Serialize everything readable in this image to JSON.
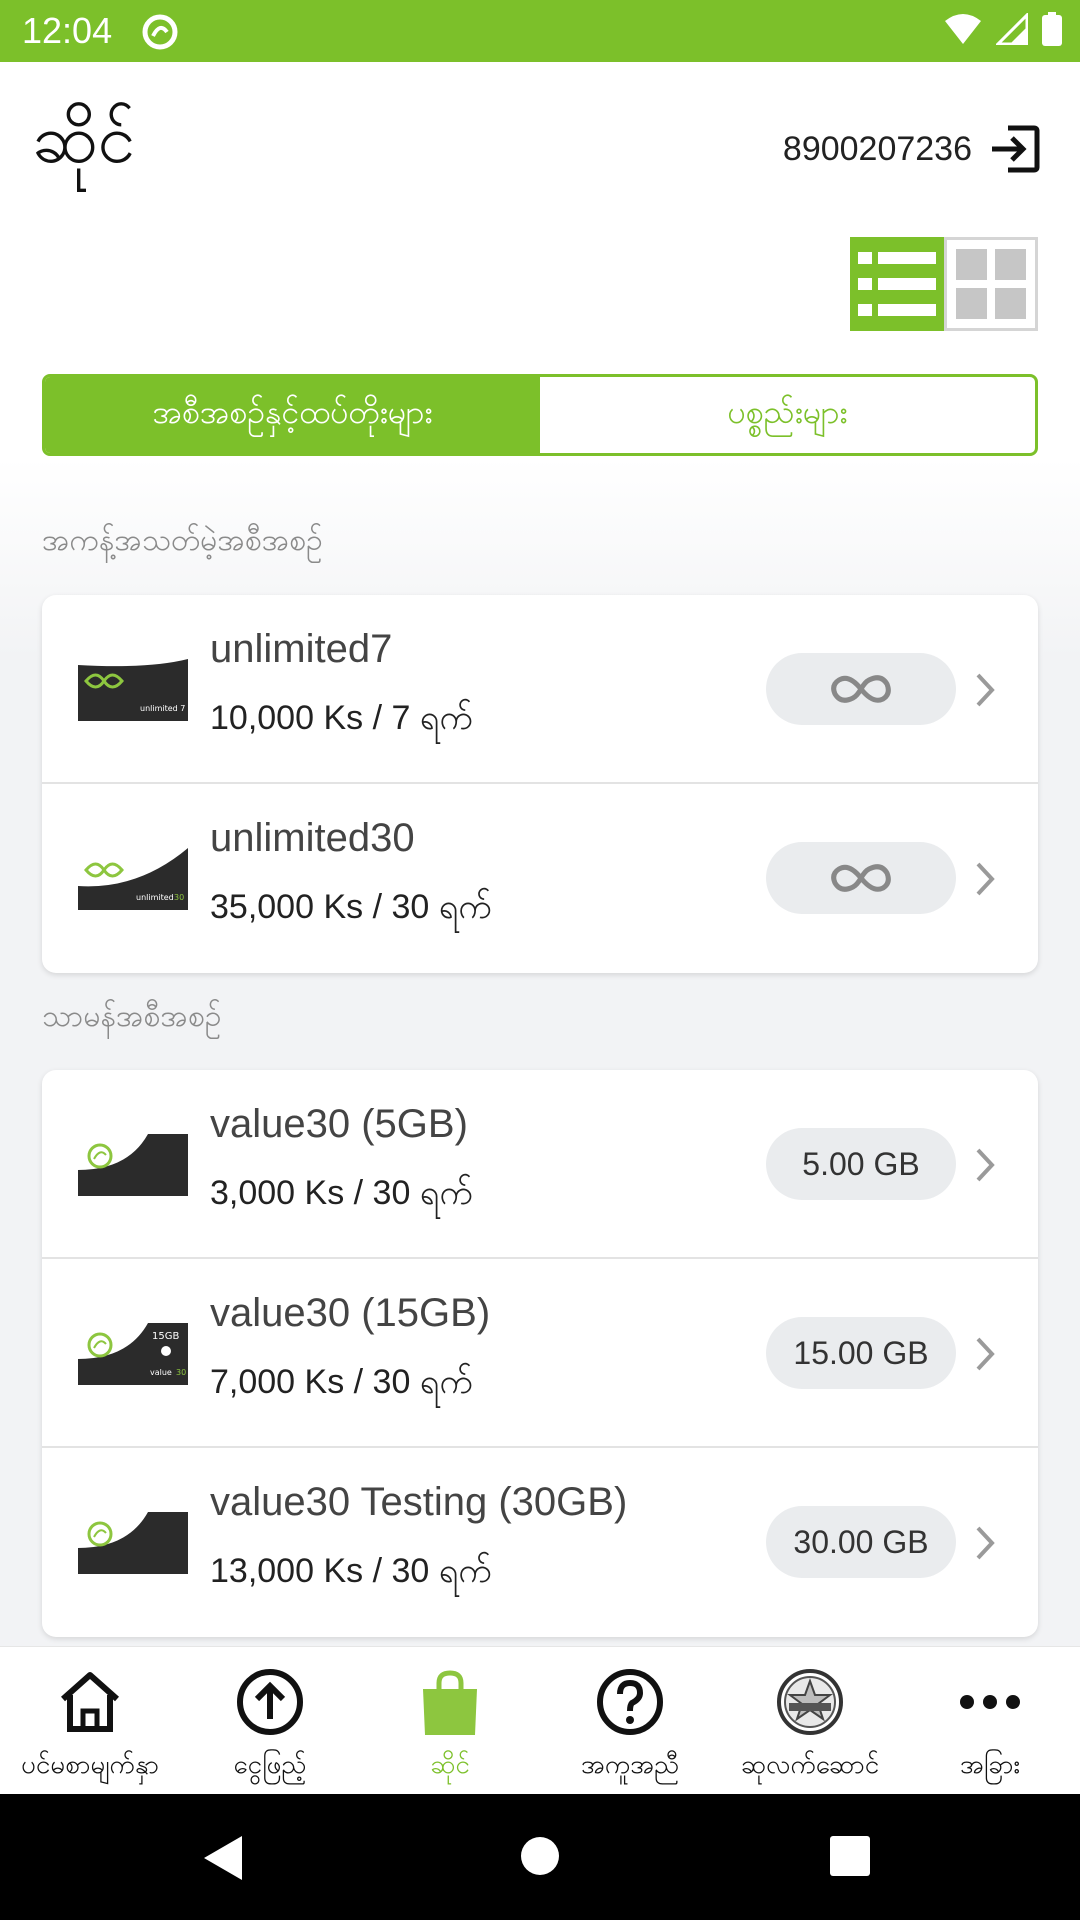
{
  "status_bar": {
    "time": "12:04"
  },
  "header": {
    "title": "ဆိုင်",
    "account_number": "8900207236"
  },
  "tabs": [
    {
      "label": "အစီအစဉ်နှင့်ထပ်တိုးများ",
      "active": true
    },
    {
      "label": "ပစ္စည်းများ",
      "active": false
    }
  ],
  "sections": [
    {
      "title": "အကန့်အသတ်မဲ့အစီအစဉ်",
      "items": [
        {
          "name": "unlimited7",
          "price": "10,000 Ks / 7 ရက်",
          "amount_icon": "infinity-icon"
        },
        {
          "name": "unlimited30",
          "price": "35,000 Ks / 30 ရက်",
          "amount_icon": "infinity-icon"
        }
      ]
    },
    {
      "title": "သာမန်အစီအစဉ်",
      "items": [
        {
          "name": "value30 (5GB)",
          "price": "3,000 Ks / 30 ရက်",
          "amount": "5.00 GB"
        },
        {
          "name": "value30 (15GB)",
          "price": "7,000 Ks / 30 ရက်",
          "amount": "15.00 GB"
        },
        {
          "name": "value30 Testing (30GB)",
          "price": "13,000 Ks / 30 ရက်",
          "amount": "30.00 GB"
        }
      ]
    }
  ],
  "bottom_nav": [
    {
      "label": "ပင်မစာမျက်နှာ",
      "icon": "home-icon",
      "active": false
    },
    {
      "label": "ငွေဖြည့်",
      "icon": "top-up-icon",
      "active": false
    },
    {
      "label": "ဆိုင်",
      "icon": "shopping-bag-icon",
      "active": true
    },
    {
      "label": "အကူအညီ",
      "icon": "help-icon",
      "active": false
    },
    {
      "label": "ဆုလက်ဆောင်",
      "icon": "rewards-icon",
      "active": false
    },
    {
      "label": "အခြား",
      "icon": "more-icon",
      "active": false
    }
  ],
  "colors": {
    "brand": "#7cc02a",
    "pill_bg": "#eaecee"
  }
}
